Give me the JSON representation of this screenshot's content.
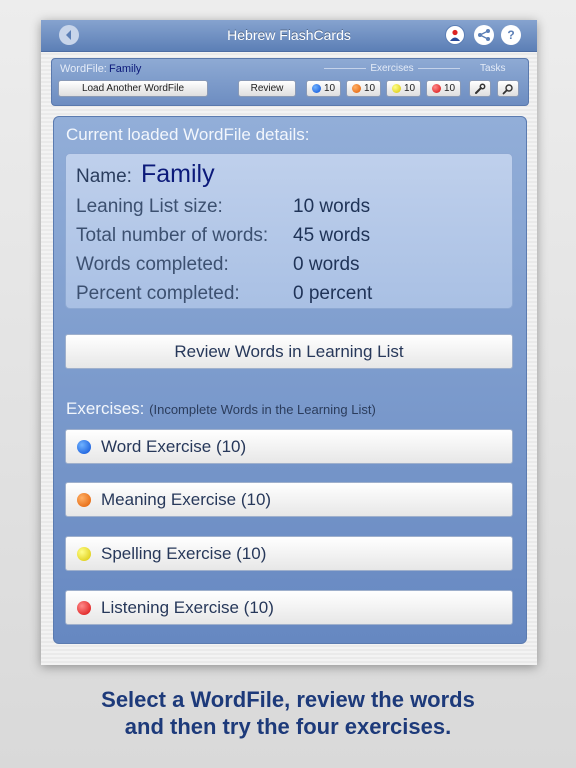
{
  "app": {
    "title": "Hebrew FlashCards"
  },
  "nav": {
    "back_icon": "back-arrow-icon",
    "user_icon": "user-icon",
    "share_icon": "share-icon",
    "help_icon": "help-icon",
    "help_glyph": "?"
  },
  "toolbar": {
    "wordfile_label": "WordFile:",
    "wordfile_name": "Family",
    "load_button": "Load Another WordFile",
    "review_button": "Review",
    "exercises_label": "Exercises",
    "tasks_label": "Tasks",
    "exercise_counts": [
      "10",
      "10",
      "10",
      "10"
    ],
    "task_icons": [
      "wrench-icon",
      "search-icon"
    ]
  },
  "details": {
    "heading": "Current loaded WordFile details:",
    "name_label": "Name:",
    "name_value": "Family",
    "stats": [
      {
        "label": "Leaning List size:",
        "value": "10 words"
      },
      {
        "label": "Total number of words:",
        "value": "45 words"
      },
      {
        "label": "Words completed:",
        "value": "0 words"
      },
      {
        "label": "Percent completed:",
        "value": "0 percent"
      }
    ]
  },
  "review_button": "Review Words in Learning List",
  "exercises": {
    "title": "Exercises:",
    "subtitle": "(Incomplete Words in the Learning List)",
    "items": [
      {
        "label": "Word Exercise (10)",
        "color": "#1565e0"
      },
      {
        "label": "Meaning Exercise (10)",
        "color": "#f06a00"
      },
      {
        "label": "Spelling Exercise (10)",
        "color": "#e8d800"
      },
      {
        "label": "Listening Exercise (10)",
        "color": "#e01010"
      }
    ]
  },
  "caption": {
    "line1": "Select a WordFile, review the words",
    "line2": "and then try the four exercises."
  },
  "colors": {
    "accent": "#0c1a7a",
    "navbar": "#5c7fb6",
    "caption": "#1d3a7a"
  }
}
